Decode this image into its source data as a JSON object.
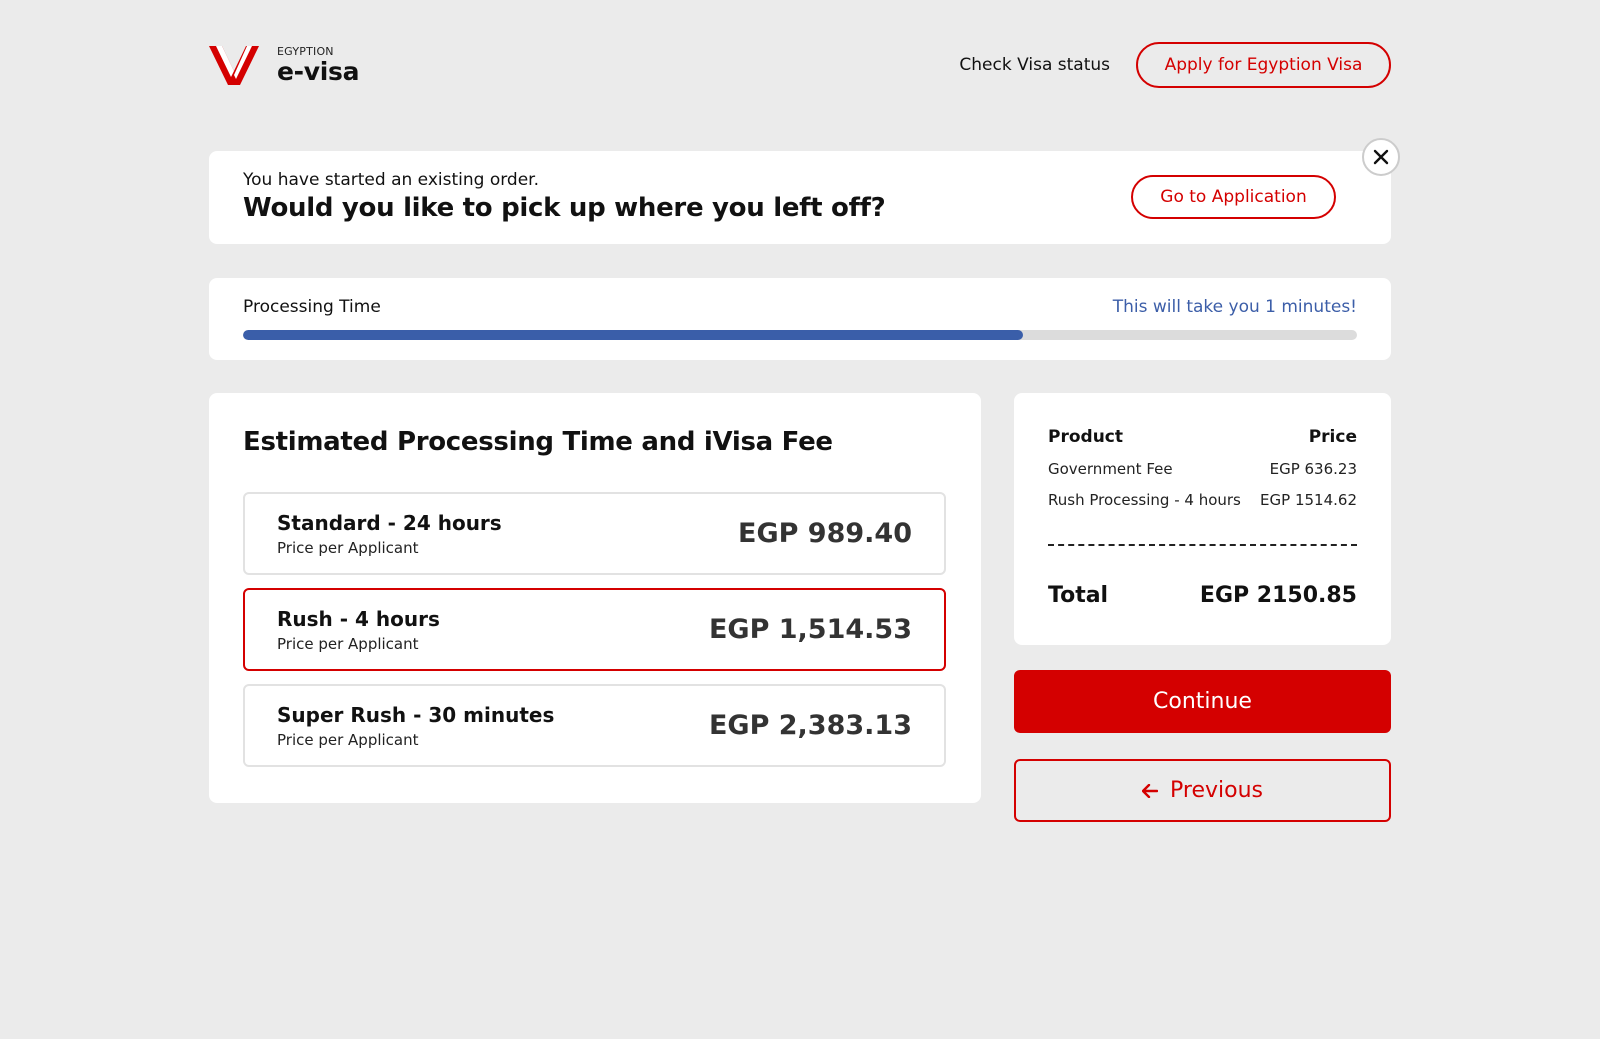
{
  "brand": {
    "small": "EGYPTION",
    "name": "e-visa",
    "logo_icon": "v-chevron-logo-icon",
    "accent_color": "#d40000"
  },
  "nav": {
    "check_status": "Check Visa status",
    "apply": "Apply for Egyption Visa"
  },
  "banner": {
    "subtitle": "You have started an existing order.",
    "title": "Would you like to pick up where you left off?",
    "go_button": "Go to Application",
    "close_icon": "close-icon"
  },
  "progress": {
    "label": "Processing Time",
    "note": "This will take you 1 minutes!",
    "value_percent": 70,
    "fill_color": "#3a5ea9"
  },
  "fees": {
    "title": "Estimated Processing Time and iVisa Fee",
    "options": [
      {
        "name": "Standard - 24 hours",
        "sub": "Price per Applicant",
        "price": "EGP 989.40",
        "selected": false
      },
      {
        "name": "Rush - 4 hours",
        "sub": "Price per Applicant",
        "price": "EGP 1,514.53",
        "selected": true
      },
      {
        "name": "Super Rush - 30 minutes",
        "sub": "Price per Applicant",
        "price": "EGP 2,383.13",
        "selected": false
      }
    ]
  },
  "summary": {
    "product_header": "Product",
    "price_header": "Price",
    "rows": [
      {
        "label": "Government Fee",
        "price": "EGP 636.23"
      },
      {
        "label": "Rush Processing - 4 hours",
        "price": "EGP 1514.62"
      }
    ],
    "total_label": "Total",
    "total_value": "EGP 2150.85"
  },
  "actions": {
    "continue": "Continue",
    "previous": "Previous",
    "previous_icon": "arrow-left-icon"
  }
}
